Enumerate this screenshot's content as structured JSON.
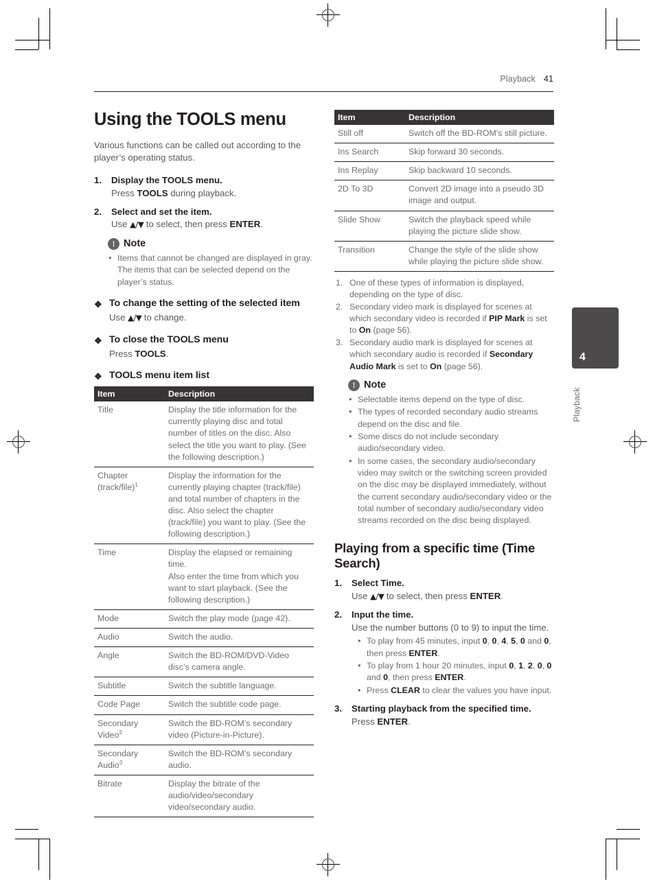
{
  "running_head": {
    "section": "Playback",
    "page_number": "41"
  },
  "thumb_tab": {
    "number": "4",
    "label": "Playback"
  },
  "left_column": {
    "title": "Using the TOOLS menu",
    "intro": "Various functions can be called out according to the player’s operating status.",
    "steps": [
      {
        "num": "1.",
        "title_parts": [
          "Display the ",
          "TOOLS",
          " menu."
        ],
        "body_parts": [
          "Press ",
          "TOOLS",
          " during playback."
        ]
      },
      {
        "num": "2.",
        "title_parts": [
          "Select and set the item."
        ],
        "body_parts": [
          "Use ",
          "▲/▼",
          " to select, then press ",
          "ENTER",
          "."
        ]
      }
    ],
    "note": {
      "icon": "exclamation-circle-icon",
      "title": "Note",
      "bullets": [
        "Items that cannot be changed are displayed in gray. The items that can be selected depend on the player’s status."
      ]
    },
    "sections": [
      {
        "heading": "To change the setting of the selected item",
        "body_parts": [
          "Use ",
          "▲/▼",
          " to change."
        ]
      },
      {
        "heading": "To close the TOOLS menu",
        "body_parts": [
          "Press ",
          "TOOLS",
          "."
        ]
      },
      {
        "heading": "TOOLS menu item list",
        "body_parts": []
      }
    ],
    "table": {
      "headers": [
        "Item",
        "Description"
      ],
      "rows": [
        {
          "item": "Title",
          "item_sup": "",
          "desc": "Display the title information for the currently playing disc and total number of titles on the disc. Also select the title you want to play. (See the following description.)"
        },
        {
          "item": "Chapter (track/file)",
          "item_sup": "1",
          "desc": "Display the information for the currently playing chapter (track/file) and total number of chapters in the disc. Also select the chapter (track/file) you want to play. (See the following description.)"
        },
        {
          "item": "Time",
          "item_sup": "",
          "desc": "Display the elapsed or remaining time.\nAlso enter the time from which you want to start playback. (See the following description.)"
        },
        {
          "item": "Mode",
          "item_sup": "",
          "desc": "Switch the play mode (page 42)."
        },
        {
          "item": "Audio",
          "item_sup": "",
          "desc": "Switch the audio."
        },
        {
          "item": "Angle",
          "item_sup": "",
          "desc": "Switch the BD-ROM/DVD-Video disc’s camera angle."
        },
        {
          "item": "Subtitle",
          "item_sup": "",
          "desc": "Switch the subtitle language."
        },
        {
          "item": "Code Page",
          "item_sup": "",
          "desc": "Switch the subtitle code page."
        },
        {
          "item": "Secondary Video",
          "item_sup": "2",
          "desc": "Switch the BD-ROM’s secondary video (Picture-in-Picture)."
        },
        {
          "item": "Secondary Audio",
          "item_sup": "3",
          "desc": "Switch the BD-ROM’s secondary audio."
        },
        {
          "item": "Bitrate",
          "item_sup": "",
          "desc": "Display the bitrate of the audio/video/secondary video/secondary audio."
        }
      ]
    }
  },
  "right_column": {
    "table": {
      "headers": [
        "Item",
        "Description"
      ],
      "rows": [
        {
          "item": "Still off",
          "desc": "Switch off the BD-ROM's still picture."
        },
        {
          "item": "Ins Search",
          "desc": "Skip forward 30 seconds."
        },
        {
          "item": "Ins Replay",
          "desc": "Skip backward 10 seconds."
        },
        {
          "item": "2D To 3D",
          "desc": "Convert 2D image into a pseudo 3D image and output."
        },
        {
          "item": "Slide Show",
          "desc": "Switch the playback speed while playing the picture slide show."
        },
        {
          "item": "Transition",
          "desc": "Change the style of the slide show while playing the picture slide show."
        }
      ]
    },
    "footnotes": [
      {
        "num": "1.",
        "parts": [
          "One of these types of information is displayed, depending on the type of disc."
        ]
      },
      {
        "num": "2.",
        "parts": [
          "Secondary video mark is displayed for scenes at which secondary video is recorded if ",
          "PIP Mark",
          " is set to ",
          "On",
          " (page 56)."
        ]
      },
      {
        "num": "3.",
        "parts": [
          "Secondary audio mark is displayed for scenes at which secondary audio is recorded if ",
          "Secondary Audio Mark",
          " is set to ",
          "On",
          " (page 56)."
        ]
      }
    ],
    "note": {
      "icon": "exclamation-circle-icon",
      "title": "Note",
      "bullets": [
        "Selectable items depend on the type of disc.",
        "The types of recorded secondary audio streams depend on the disc and file.",
        "Some discs do not include secondary audio/secondary video.",
        "In some cases, the secondary audio/secondary video may switch or the switching screen provided on the disc may be displayed immediately, without the current secondary audio/secondary video or the total number of secondary audio/secondary video streams recorded on the disc being displayed."
      ]
    },
    "subhead": "Playing from a specific time (Time Search)",
    "steps": [
      {
        "num": "1.",
        "title_parts": [
          "Select Time."
        ],
        "body_parts": [
          "Use ",
          "▲/▼",
          " to select, then press ",
          "ENTER",
          "."
        ]
      },
      {
        "num": "2.",
        "title_parts": [
          "Input the time."
        ],
        "body_parts": [
          "Use the number buttons (0 to 9) to input the time."
        ],
        "bullets": [
          [
            "To play from 45 minutes, input ",
            "0",
            ", ",
            "0",
            ", ",
            "4",
            ", ",
            "5",
            ", ",
            "0",
            " and ",
            "0",
            ", then press ",
            "ENTER",
            "."
          ],
          [
            "To play from 1 hour 20 minutes, input ",
            "0",
            ", ",
            "1",
            ", ",
            "2",
            ", ",
            "0",
            ", ",
            "0",
            " and ",
            "0",
            ", then press ",
            "ENTER",
            "."
          ],
          [
            "Press ",
            "CLEAR",
            " to clear the values you have input."
          ]
        ]
      },
      {
        "num": "3.",
        "title_parts": [
          "Starting playback from the specified time."
        ],
        "body_parts": [
          "Press ",
          "ENTER",
          "."
        ]
      }
    ]
  },
  "colors": {
    "table_header_bg": "#373435",
    "body_text": "#6d6e71",
    "heading_text": "#231f20",
    "thumb_tab_bg": "#4c4a4b"
  }
}
